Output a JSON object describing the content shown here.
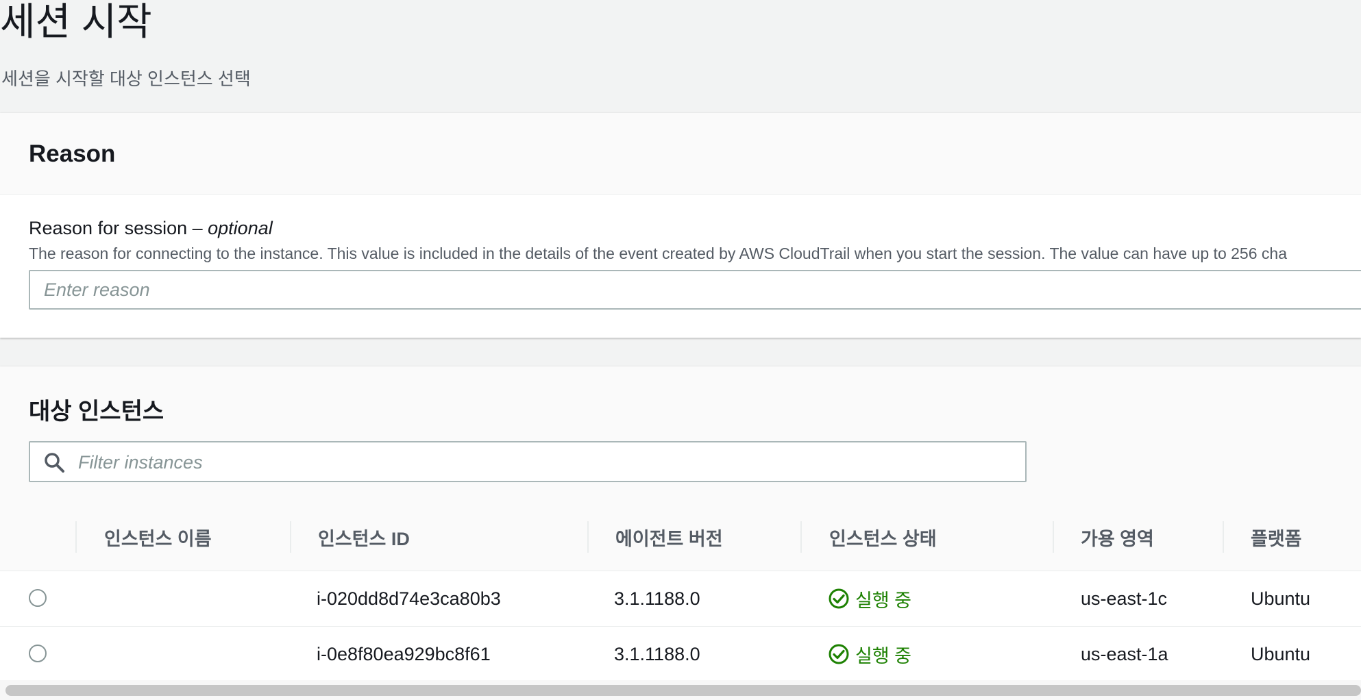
{
  "page": {
    "title": "세션 시작",
    "subtitle": "세션을 시작할 대상 인스턴스 선택"
  },
  "reason_panel": {
    "header": "Reason",
    "label_main": "Reason for session – ",
    "label_optional": "optional",
    "description": "The reason for connecting to the instance. This value is included in the details of the event created by AWS CloudTrail when you start the session. The value can have up to 256 cha",
    "input_placeholder": "Enter reason",
    "input_value": ""
  },
  "instances_panel": {
    "header": "대상 인스턴스",
    "filter_placeholder": "Filter instances",
    "filter_icon": "search-icon",
    "columns": [
      "인스턴스 이름",
      "인스턴스 ID",
      "에이전트 버전",
      "인스턴스 상태",
      "가용 영역",
      "플랫폼"
    ],
    "rows": [
      {
        "name": "",
        "id": "i-020dd8d74e3ca80b3",
        "agent_version": "3.1.1188.0",
        "status": "실행 중",
        "az": "us-east-1c",
        "platform": "Ubuntu",
        "selected": false
      },
      {
        "name": "",
        "id": "i-0e8f80ea929bc8f61",
        "agent_version": "3.1.1188.0",
        "status": "실행 중",
        "az": "us-east-1a",
        "platform": "Ubuntu",
        "selected": false
      }
    ],
    "status_icon": "check-circle-icon"
  },
  "colors": {
    "status_running": "#1d8102",
    "background": "#f2f3f3",
    "input_border": "#aab7b8"
  }
}
